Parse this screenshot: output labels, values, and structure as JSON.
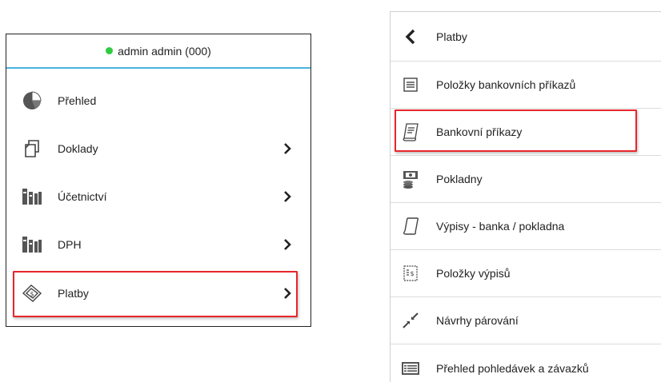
{
  "left_menu": {
    "user_status": "admin admin (000)",
    "items": [
      {
        "label": "Přehled",
        "icon": "pie-chart-icon",
        "has_submenu": false
      },
      {
        "label": "Doklady",
        "icon": "documents-icon",
        "has_submenu": true
      },
      {
        "label": "Účetnictví",
        "icon": "books-icon",
        "has_submenu": true
      },
      {
        "label": "DPH",
        "icon": "books-icon",
        "has_submenu": true
      },
      {
        "label": "Platby",
        "icon": "payment-icon",
        "has_submenu": true
      }
    ]
  },
  "right_menu": {
    "back_label": "Platby",
    "items": [
      {
        "label": "Položky bankovních příkazů",
        "icon": "list-document-icon"
      },
      {
        "label": "Bankovní příkazy",
        "icon": "bank-order-icon"
      },
      {
        "label": "Pokladny",
        "icon": "cash-register-icon"
      },
      {
        "label": "Výpisy - banka / pokladna",
        "icon": "statement-scroll-icon"
      },
      {
        "label": "Položky výpisů",
        "icon": "statement-item-icon"
      },
      {
        "label": "Návrhy párování",
        "icon": "pairing-arrows-icon"
      },
      {
        "label": "Přehled pohledávek a závazků",
        "icon": "overview-list-icon"
      }
    ]
  },
  "colors": {
    "highlight": "#e8262b",
    "header_line": "#4ab3e0",
    "status_online": "#2ecc40"
  }
}
